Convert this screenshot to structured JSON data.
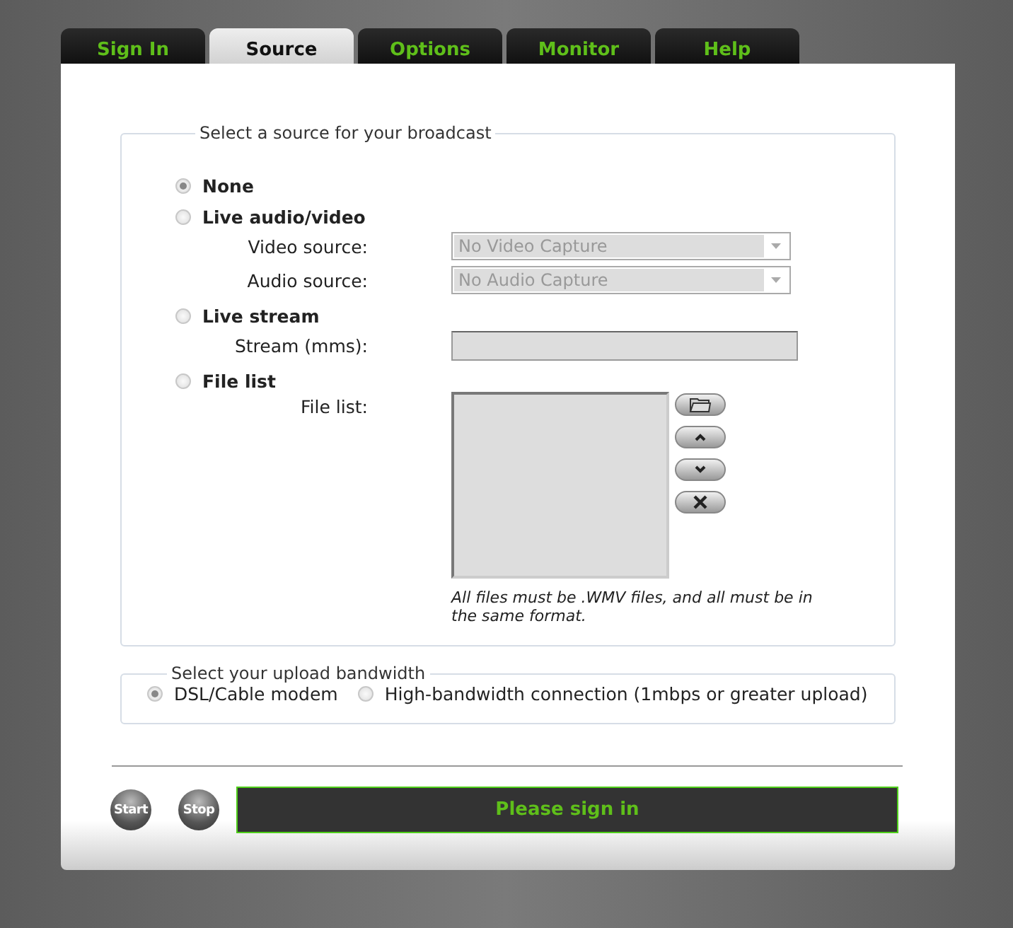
{
  "tabs": [
    {
      "label": "Sign In",
      "selected": false
    },
    {
      "label": "Source",
      "selected": true
    },
    {
      "label": "Options",
      "selected": false
    },
    {
      "label": "Monitor",
      "selected": false
    },
    {
      "label": "Help",
      "selected": false
    }
  ],
  "source": {
    "legend": "Select a source for your broadcast",
    "options": [
      {
        "label": "None",
        "selected": true
      },
      {
        "label": "Live audio/video",
        "selected": false,
        "fields": [
          {
            "kind": "select",
            "label": "Video source:",
            "value": "No Video Capture",
            "disabled": true
          },
          {
            "kind": "select",
            "label": "Audio source:",
            "value": "No Audio Capture",
            "disabled": true
          }
        ]
      },
      {
        "label": "Live stream",
        "selected": false,
        "fields": [
          {
            "kind": "text",
            "label": "Stream (mms):",
            "disabled": true
          }
        ]
      },
      {
        "label": "File list",
        "selected": false,
        "fields": [
          {
            "kind": "list",
            "label": "File list:",
            "disabled": true
          }
        ]
      }
    ],
    "note": "All files must be .WMV files, and all must be in the same format."
  },
  "bandwidth": {
    "legend": "Select your upload bandwidth",
    "options": [
      {
        "label": "DSL/Cable modem",
        "selected": true
      },
      {
        "label": "High-bandwidth connection (1mbps or greater upload)",
        "selected": false
      }
    ]
  },
  "buttons": [
    {
      "label": "Start"
    },
    {
      "label": "Stop"
    }
  ],
  "status": "Please sign in"
}
